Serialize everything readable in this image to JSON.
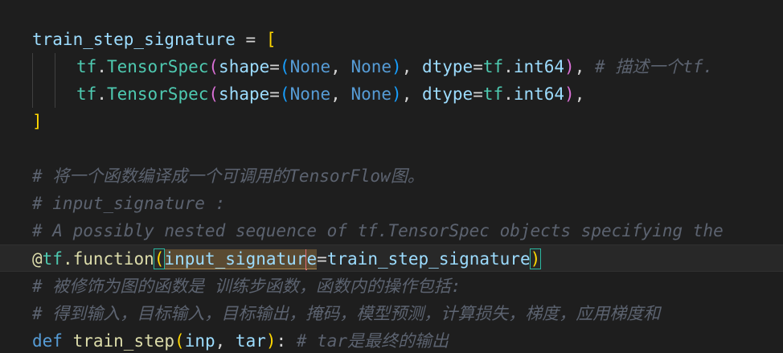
{
  "code": {
    "l1": {
      "name": "train_step_signature",
      "eq": " = ",
      "open": "["
    },
    "l2": {
      "tf": "tf",
      "dot": ".",
      "cls": "TensorSpec",
      "p1": "(",
      "kw_shape": "shape",
      "eq": "=",
      "p2": "(",
      "none1": "None",
      "comma": ", ",
      "none2": "None",
      "p2c": ")",
      "comma2": ", ",
      "kw_dtype": "dtype",
      "eq2": "=",
      "tf2": "tf",
      "dot2": ".",
      "int64": "int64",
      "p1c": ")",
      "trail": ", ",
      "comment": "# 描述一个tf."
    },
    "l3": {
      "tf": "tf",
      "dot": ".",
      "cls": "TensorSpec",
      "p1": "(",
      "kw_shape": "shape",
      "eq": "=",
      "p2": "(",
      "none1": "None",
      "comma": ", ",
      "none2": "None",
      "p2c": ")",
      "comma2": ", ",
      "kw_dtype": "dtype",
      "eq2": "=",
      "tf2": "tf",
      "dot2": ".",
      "int64": "int64",
      "p1c": ")",
      "trail": ","
    },
    "l4": {
      "close": "]"
    },
    "l6": "# 将一个函数编译成一个可调用的TensorFlow图。",
    "l7": "# input_signature :",
    "l8": "# A possibly nested sequence of tf.TensorSpec objects specifying the",
    "l9": {
      "at": "@",
      "tf": "tf",
      "dot": ".",
      "fn": "function",
      "open": "(",
      "param_a": "input_signatur",
      "param_b": "e",
      "eq": "=",
      "val": "train_step_signature",
      "close": ")"
    },
    "l10": "# 被修饰为图的函数是 训练步函数，函数内的操作包括:",
    "l11": "# 得到输入，目标输入，目标输出，掩码，模型预测，计算损失，梯度，应用梯度和",
    "l12": {
      "def": "def",
      "sp": " ",
      "fn": "train_step",
      "open": "(",
      "a1": "inp",
      "comma": ", ",
      "a2": "tar",
      "close": ")",
      "colon": ": ",
      "comment": "# tar是最终的输出"
    }
  }
}
